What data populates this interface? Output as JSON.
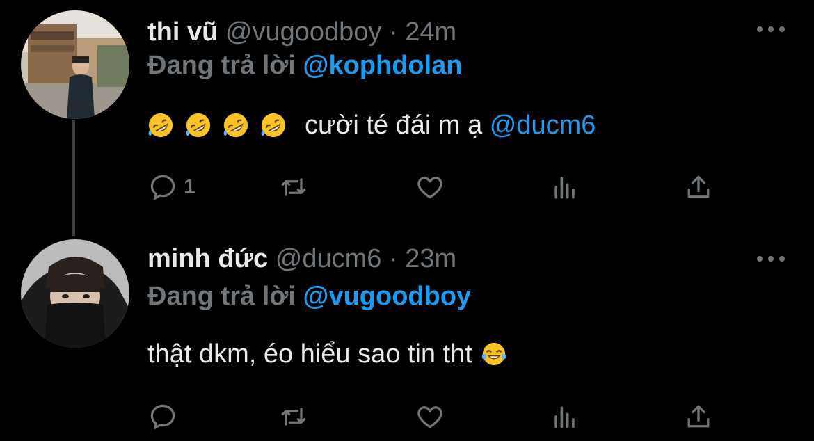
{
  "colors": {
    "background": "#000000",
    "text": "#e7e9ea",
    "muted": "#71767b",
    "accent": "#1d9bf0"
  },
  "tweets": [
    {
      "display_name": "thi vũ",
      "handle": "@vugoodboy",
      "separator": "·",
      "time": "24m",
      "reply_prefix": "Đang trả lời",
      "reply_to": "@kophdolan",
      "text": "cười té đái m ạ",
      "mention": "@ducm6",
      "leading_emojis": [
        "rolling-on-floor-laughing",
        "rolling-on-floor-laughing",
        "rolling-on-floor-laughing",
        "rolling-on-floor-laughing"
      ],
      "reply_count": "1",
      "icons": [
        "reply-icon",
        "retweet-icon",
        "like-icon",
        "views-icon",
        "share-icon",
        "more-icon"
      ]
    },
    {
      "display_name": "minh đức",
      "handle": "@ducm6",
      "separator": "·",
      "time": "23m",
      "reply_prefix": "Đang trả lời",
      "reply_to": "@vugoodboy",
      "text": "thật dkm, éo hiểu sao tin tht",
      "trailing_emoji": "face-with-tears-of-joy",
      "reply_count": "",
      "icons": [
        "reply-icon",
        "retweet-icon",
        "like-icon",
        "views-icon",
        "share-icon",
        "more-icon"
      ]
    }
  ]
}
